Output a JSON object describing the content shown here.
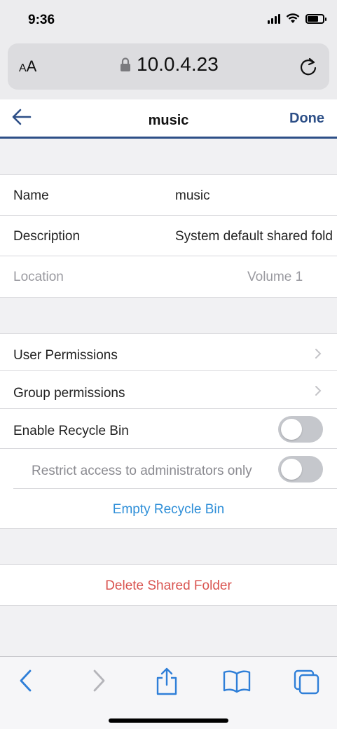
{
  "status_bar": {
    "time": "9:36"
  },
  "browser": {
    "text_size_small": "A",
    "text_size_large": "A",
    "url": "10.0.4.23"
  },
  "header": {
    "title": "music",
    "done_label": "Done"
  },
  "info": {
    "name_label": "Name",
    "name_value": "music",
    "description_label": "Description",
    "description_value": "System default shared fold",
    "location_label": "Location",
    "location_value": "Volume 1"
  },
  "settings": {
    "user_permissions": "User Permissions",
    "group_permissions": "Group permissions",
    "enable_recycle_bin": "Enable Recycle Bin",
    "enable_recycle_bin_on": false,
    "restrict_access": "Restrict access to administrators only",
    "restrict_access_on": false,
    "empty_recycle_bin": "Empty Recycle Bin"
  },
  "danger": {
    "delete_label": "Delete Shared Folder"
  },
  "colors": {
    "accent": "#2d4f87",
    "link": "#2f8fd8",
    "danger": "#d9534f"
  }
}
